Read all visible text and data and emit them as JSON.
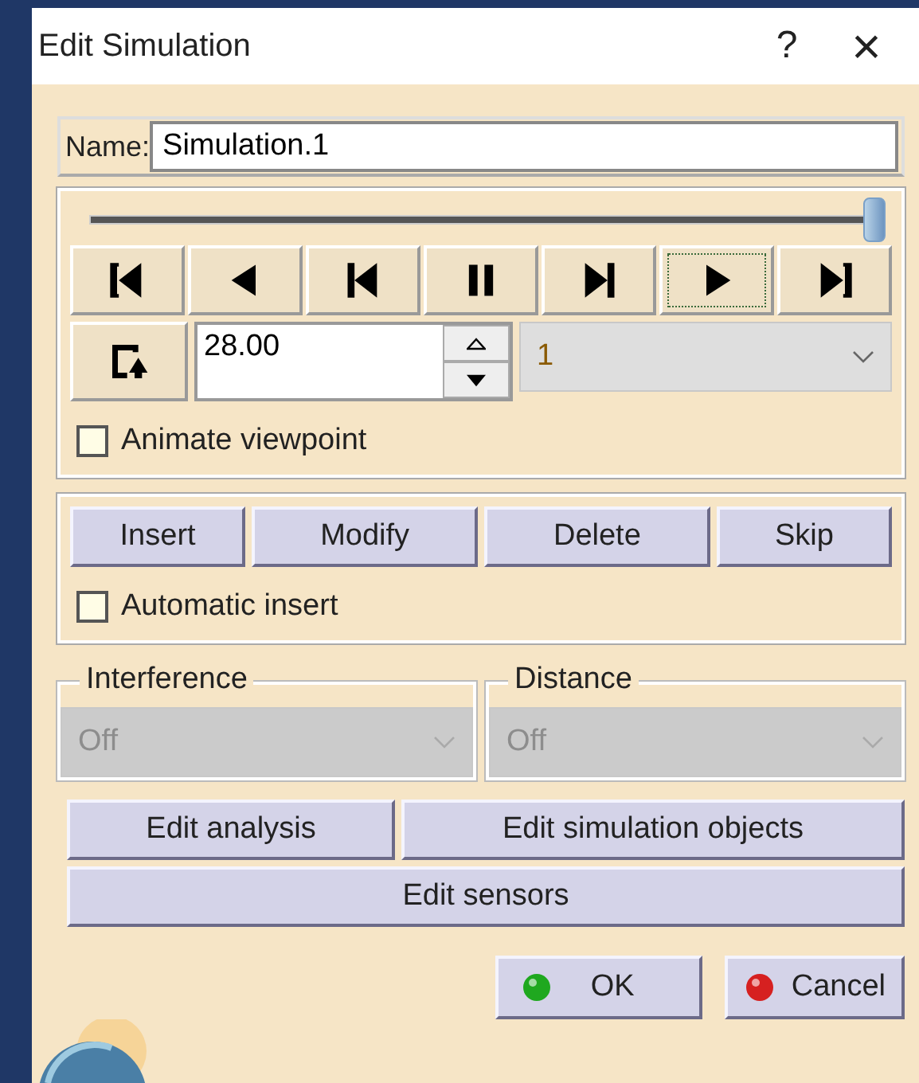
{
  "window": {
    "title": "Edit Simulation",
    "help": "?",
    "close": "×"
  },
  "name_field": {
    "label": "Name:",
    "value": "Simulation.1"
  },
  "slider": {
    "level": 1.0
  },
  "transport": [
    {
      "kind": "first",
      "selected": false
    },
    {
      "kind": "back",
      "selected": false
    },
    {
      "kind": "step-back",
      "selected": false
    },
    {
      "kind": "pause",
      "selected": false
    },
    {
      "kind": "step-forward",
      "selected": false
    },
    {
      "kind": "play",
      "selected": true
    },
    {
      "kind": "last",
      "selected": false
    }
  ],
  "time_field": {
    "value": "28.00"
  },
  "step_dropdown": {
    "value": "1"
  },
  "animate_viewpoint": {
    "label": "Animate viewpoint",
    "checked": false
  },
  "actions": [
    "Insert",
    "Modify",
    "Delete",
    "Skip"
  ],
  "automatic_insert": {
    "label": "Automatic insert",
    "checked": false
  },
  "groups": [
    {
      "title": "Interference",
      "value": "Off",
      "disabled": true
    },
    {
      "title": "Distance",
      "value": "Off",
      "disabled": true
    }
  ],
  "edit_buttons": [
    "Edit analysis",
    "Edit simulation objects",
    "Edit sensors"
  ],
  "footer": [
    {
      "kind": "ok",
      "label": "OK"
    },
    {
      "kind": "cancel",
      "label": "Cancel"
    }
  ]
}
